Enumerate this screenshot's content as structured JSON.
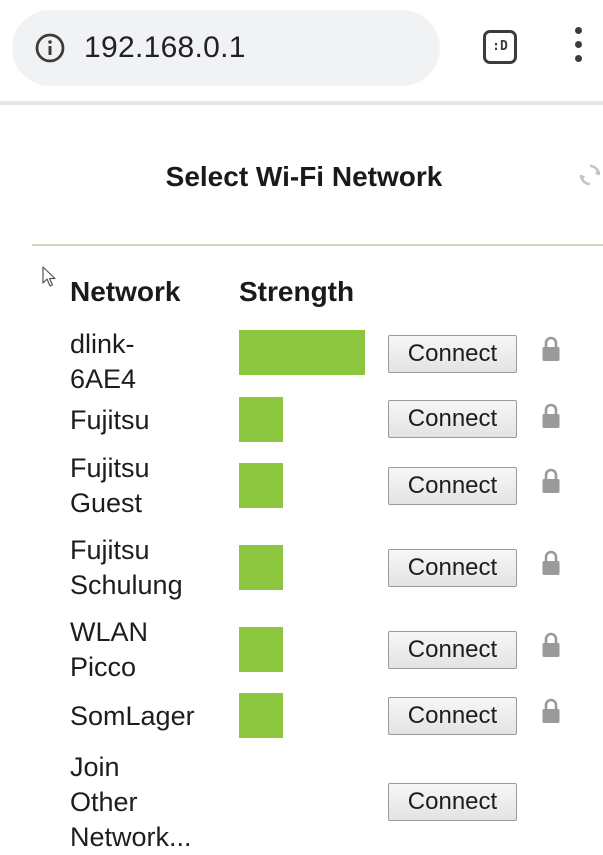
{
  "browser": {
    "url": "192.168.0.1",
    "tab_icon_text": ":D"
  },
  "page": {
    "title": "Select Wi-Fi Network"
  },
  "table": {
    "headers": [
      "Network",
      "Strength"
    ],
    "rows": [
      {
        "name": "dlink-\n6AE4",
        "strength": 1.0,
        "action": "Connect",
        "locked": true
      },
      {
        "name": "Fujitsu",
        "strength": 0.35,
        "action": "Connect",
        "locked": true
      },
      {
        "name": "Fujitsu\nGuest",
        "strength": 0.35,
        "action": "Connect",
        "locked": true
      },
      {
        "name": "Fujitsu\nSchulung",
        "strength": 0.35,
        "action": "Connect",
        "locked": true
      },
      {
        "name": "WLAN\nPicco",
        "strength": 0.35,
        "action": "Connect",
        "locked": true
      },
      {
        "name": "SomLager",
        "strength": 0.35,
        "action": "Connect",
        "locked": true
      },
      {
        "name": "Join\nOther\nNetwork...",
        "strength": null,
        "action": "Connect",
        "locked": false
      }
    ]
  },
  "colors": {
    "strength_bar": "#8cc63f",
    "accent_rule": "#cfd8b9"
  },
  "icons": {
    "info": "info-icon",
    "tabs": "tab-switcher-icon",
    "menu": "more-vert-icon",
    "refresh": "refresh-icon",
    "cursor": "mouse-cursor-icon",
    "lock": "lock-icon"
  }
}
